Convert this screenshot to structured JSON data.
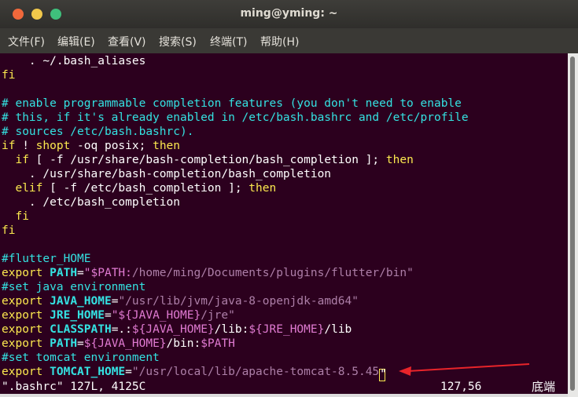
{
  "window": {
    "title": "ming@yming: ~"
  },
  "menubar": {
    "items": [
      "文件(F)",
      "编辑(E)",
      "查看(V)",
      "搜索(S)",
      "终端(T)",
      "帮助(H)"
    ]
  },
  "editor": {
    "lines": [
      [
        {
          "t": "    . ~/.bash_aliases",
          "c": "w"
        }
      ],
      [
        {
          "t": "fi",
          "c": "y"
        }
      ],
      [
        {
          "t": "",
          "c": "w"
        }
      ],
      [
        {
          "t": "# enable programmable completion features (you don't need to enable",
          "c": "c"
        }
      ],
      [
        {
          "t": "# this, if it's already enabled in /etc/bash.bashrc and /etc/profile",
          "c": "c"
        }
      ],
      [
        {
          "t": "# sources /etc/bash.bashrc).",
          "c": "c"
        }
      ],
      [
        {
          "t": "if",
          "c": "y"
        },
        {
          "t": " ! ",
          "c": "w"
        },
        {
          "t": "shopt",
          "c": "y"
        },
        {
          "t": " -oq posix; ",
          "c": "w"
        },
        {
          "t": "then",
          "c": "y"
        }
      ],
      [
        {
          "t": "  ",
          "c": "w"
        },
        {
          "t": "if",
          "c": "y"
        },
        {
          "t": " [ -f /usr/share/bash-completion/bash_completion ]; ",
          "c": "w"
        },
        {
          "t": "then",
          "c": "y"
        }
      ],
      [
        {
          "t": "    . /usr/share/bash-completion/bash_completion",
          "c": "w"
        }
      ],
      [
        {
          "t": "  ",
          "c": "w"
        },
        {
          "t": "elif",
          "c": "y"
        },
        {
          "t": " [ -f /etc/bash_completion ]; ",
          "c": "w"
        },
        {
          "t": "then",
          "c": "y"
        }
      ],
      [
        {
          "t": "    . /etc/bash_completion",
          "c": "w"
        }
      ],
      [
        {
          "t": "  ",
          "c": "w"
        },
        {
          "t": "fi",
          "c": "y"
        }
      ],
      [
        {
          "t": "fi",
          "c": "y"
        }
      ],
      [
        {
          "t": "",
          "c": "w"
        }
      ],
      [
        {
          "t": "#flutter_HOME",
          "c": "c"
        }
      ],
      [
        {
          "t": "export",
          "c": "y"
        },
        {
          "t": " ",
          "c": "w"
        },
        {
          "t": "PATH",
          "c": "g"
        },
        {
          "t": "=",
          "c": "w"
        },
        {
          "t": "\"$PATH:",
          "c": "m"
        },
        {
          "t": "/home/ming/Documents/plugins/flutter/bin\"",
          "c": "p"
        }
      ],
      [
        {
          "t": "#set java environment",
          "c": "c"
        }
      ],
      [
        {
          "t": "export",
          "c": "y"
        },
        {
          "t": " ",
          "c": "w"
        },
        {
          "t": "JAVA_HOME",
          "c": "g"
        },
        {
          "t": "=",
          "c": "w"
        },
        {
          "t": "\"/usr/lib/jvm/java-8-openjdk-amd64\"",
          "c": "p"
        }
      ],
      [
        {
          "t": "export",
          "c": "y"
        },
        {
          "t": " ",
          "c": "w"
        },
        {
          "t": "JRE_HOME",
          "c": "g"
        },
        {
          "t": "=",
          "c": "w"
        },
        {
          "t": "\"${JAVA_HOME}",
          "c": "m"
        },
        {
          "t": "/jre\"",
          "c": "p"
        }
      ],
      [
        {
          "t": "export",
          "c": "y"
        },
        {
          "t": " ",
          "c": "w"
        },
        {
          "t": "CLASSPATH",
          "c": "g"
        },
        {
          "t": "=.:",
          "c": "w"
        },
        {
          "t": "${JAVA_HOME}",
          "c": "m"
        },
        {
          "t": "/lib:",
          "c": "w"
        },
        {
          "t": "${JRE_HOME}",
          "c": "m"
        },
        {
          "t": "/lib",
          "c": "w"
        }
      ],
      [
        {
          "t": "export",
          "c": "y"
        },
        {
          "t": " ",
          "c": "w"
        },
        {
          "t": "PATH",
          "c": "g"
        },
        {
          "t": "=",
          "c": "w"
        },
        {
          "t": "${JAVA_HOME}",
          "c": "m"
        },
        {
          "t": "/bin:",
          "c": "w"
        },
        {
          "t": "$PATH",
          "c": "m"
        }
      ],
      [
        {
          "t": "#set tomcat environment",
          "c": "c"
        }
      ],
      [
        {
          "t": "export",
          "c": "y"
        },
        {
          "t": " ",
          "c": "w"
        },
        {
          "t": "TOMCAT_HOME",
          "c": "g"
        },
        {
          "t": "=",
          "c": "w"
        },
        {
          "t": "\"/usr/local/lib/apache-tomcat-8.5.45",
          "c": "p"
        },
        {
          "t": "\"",
          "c": "cursor"
        }
      ]
    ]
  },
  "statusline": {
    "file_info": "\".bashrc\" 127L, 4125C",
    "position": "127,56",
    "scroll": "底端"
  },
  "annotation": {
    "arrow_color": "#e8242a"
  }
}
